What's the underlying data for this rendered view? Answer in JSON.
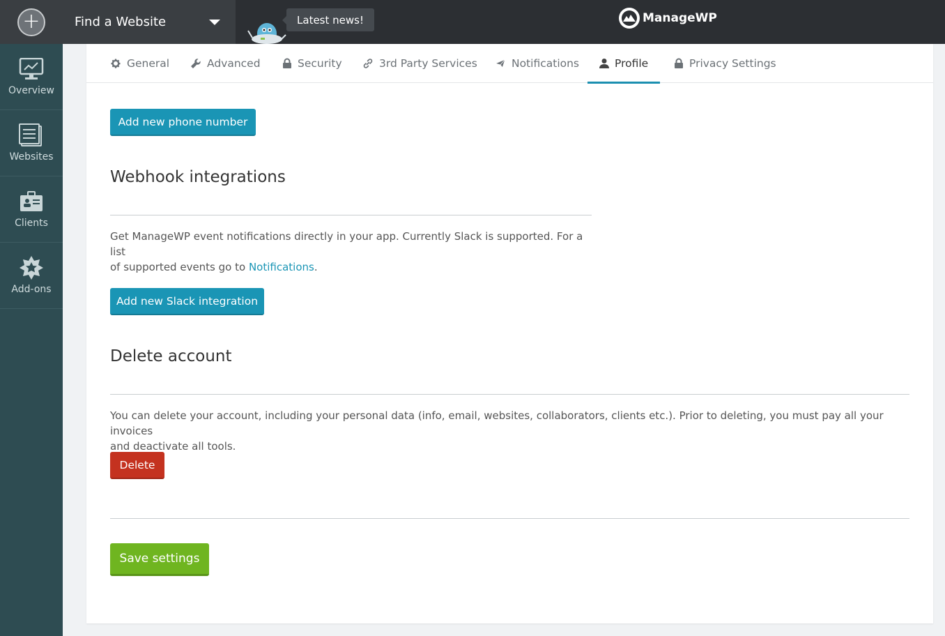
{
  "topbar": {
    "find_website": "Find a Website",
    "latest_news": "Latest news!",
    "brand": "ManageWP"
  },
  "sidebar": {
    "items": [
      {
        "label": "Overview",
        "icon": "overview-monitor-icon"
      },
      {
        "label": "Websites",
        "icon": "websites-list-icon"
      },
      {
        "label": "Clients",
        "icon": "clients-briefcase-icon"
      },
      {
        "label": "Add-ons",
        "icon": "addons-star-icon"
      }
    ]
  },
  "tabs": [
    {
      "label": "General",
      "icon": "gear-icon"
    },
    {
      "label": "Advanced",
      "icon": "wrench-icon"
    },
    {
      "label": "Security",
      "icon": "lock-icon"
    },
    {
      "label": "3rd Party Services",
      "icon": "link-icon"
    },
    {
      "label": "Notifications",
      "icon": "paper-plane-icon"
    },
    {
      "label": "Profile",
      "icon": "user-icon",
      "active": true
    },
    {
      "label": "Privacy Settings",
      "icon": "lock-icon"
    }
  ],
  "phone": {
    "add_button": "Add new phone number"
  },
  "webhook": {
    "title": "Webhook integrations",
    "desc_line1": "Get ManageWP event notifications directly in your app. Currently Slack is supported. For a list",
    "desc_line2_prefix": "of supported events go to ",
    "desc_link": "Notifications",
    "desc_suffix": ".",
    "add_button": "Add new Slack integration"
  },
  "delete_account": {
    "title": "Delete account",
    "desc_line1": "You can delete your account, including your personal data (info, email, websites, collaborators, clients etc.). Prior to deleting, you must pay all your invoices",
    "desc_line2": "and deactivate all tools.",
    "delete_button": "Delete"
  },
  "footer": {
    "save_button": "Save settings"
  },
  "colors": {
    "topbar": "#2c2f33",
    "sidebar": "#2e4c52",
    "accent_blue": "#1a95b5",
    "danger_red": "#c4321f",
    "success_green": "#6fb520"
  }
}
